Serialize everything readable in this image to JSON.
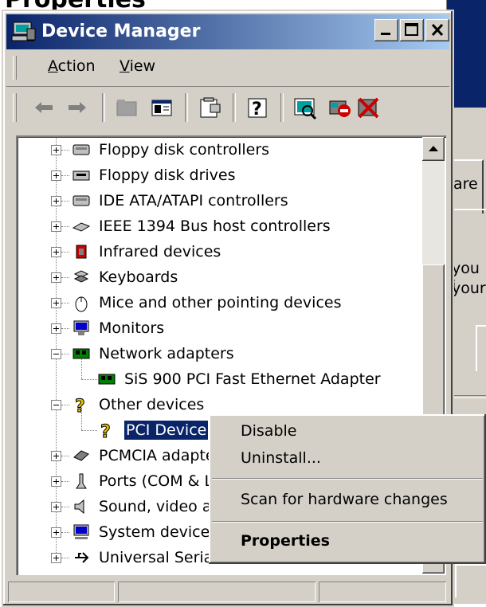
{
  "top_cut_title": "Properties",
  "window": {
    "title": "Device Manager"
  },
  "menu": {
    "action": "Action",
    "action_u": "A",
    "view": "View",
    "view_u": "V"
  },
  "tree": {
    "items": [
      {
        "label": "Floppy disk controllers",
        "icon": "floppy-controller-icon"
      },
      {
        "label": "Floppy disk drives",
        "icon": "floppy-drive-icon"
      },
      {
        "label": "IDE ATA/ATAPI controllers",
        "icon": "ide-controller-icon"
      },
      {
        "label": "IEEE 1394 Bus host controllers",
        "icon": "ieee1394-icon"
      },
      {
        "label": "Infrared devices",
        "icon": "infrared-icon"
      },
      {
        "label": "Keyboards",
        "icon": "keyboard-icon"
      },
      {
        "label": "Mice and other pointing devices",
        "icon": "mouse-icon"
      },
      {
        "label": "Monitors",
        "icon": "monitor-icon"
      },
      {
        "label": "Network adapters",
        "icon": "network-adapter-icon"
      },
      {
        "label": "SiS 900 PCI Fast Ethernet Adapter",
        "icon": "network-adapter-icon"
      },
      {
        "label": "Other devices",
        "icon": "unknown-device-icon"
      },
      {
        "label": "PCI Device",
        "icon": "unknown-device-icon"
      },
      {
        "label": "PCMCIA adapters",
        "icon": "pcmcia-icon"
      },
      {
        "label": "Ports (COM & LPT)",
        "icon": "port-icon"
      },
      {
        "label": "Sound, video and game controllers",
        "icon": "sound-icon"
      },
      {
        "label": "System devices",
        "icon": "system-device-icon"
      },
      {
        "label": "Universal Serial Bus controllers",
        "icon": "usb-icon"
      }
    ]
  },
  "context_menu": {
    "disable": "Disable",
    "uninstall": "Uninstall...",
    "scan": "Scan for hardware changes",
    "properties": "Properties"
  },
  "background_dialog": {
    "tab_fragment": "are",
    "text1": "you i",
    "text2": "your"
  }
}
